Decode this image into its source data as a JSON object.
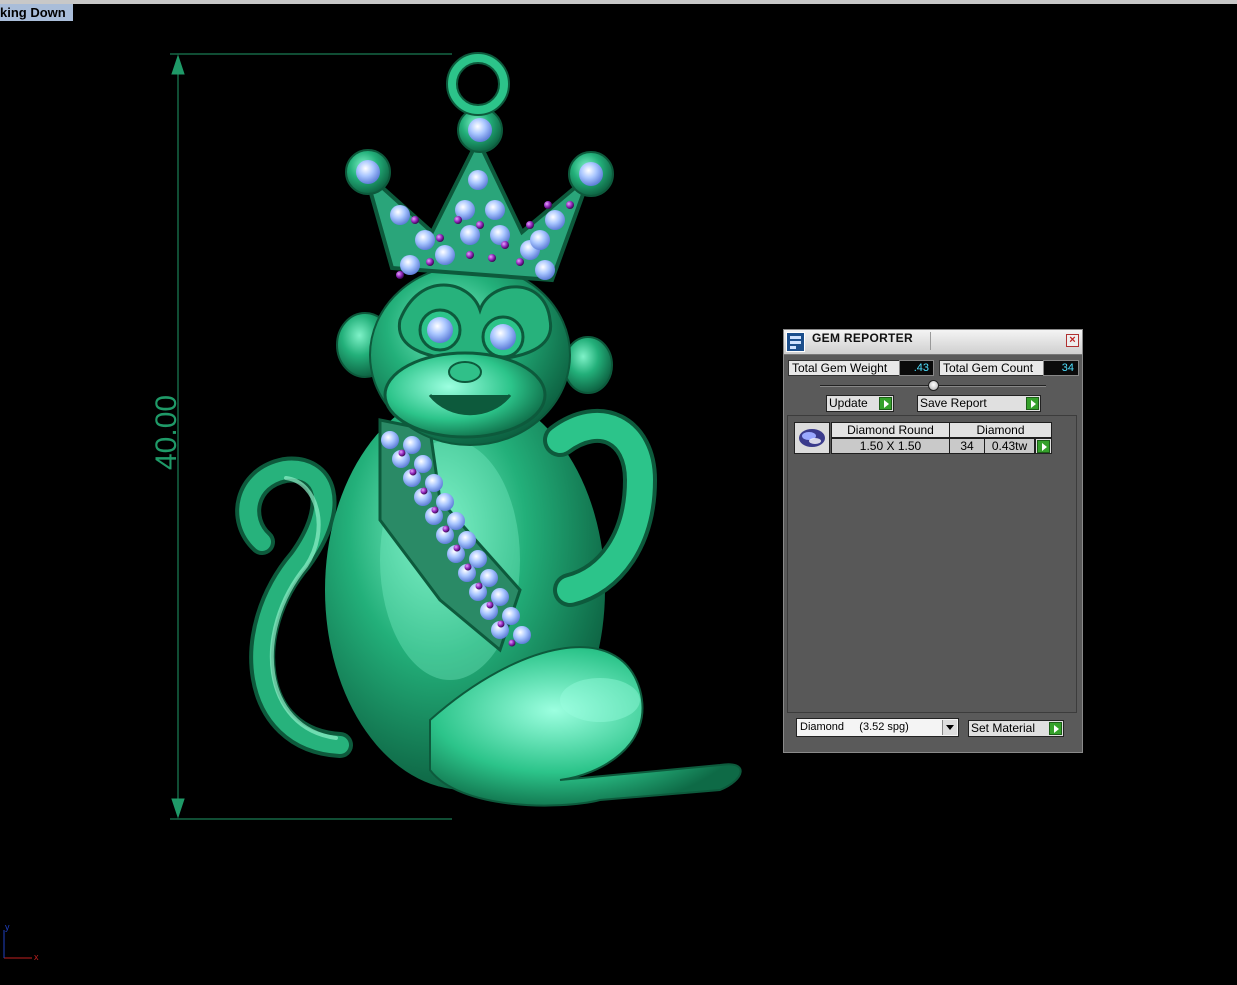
{
  "viewport": {
    "title": "king Down"
  },
  "dimension": {
    "value_label": "40.00"
  },
  "axes": {
    "x_label": "x",
    "y_label": "y"
  },
  "gem_reporter": {
    "title": "GEM REPORTER",
    "close_glyph": "×",
    "total_weight_label": "Total Gem Weight",
    "total_weight_value": ".43",
    "total_count_label": "Total Gem Count",
    "total_count_value": "34",
    "update_label": "Update",
    "save_report_label": "Save Report",
    "table": {
      "headers": [
        "Diamond Round",
        "Diamond"
      ],
      "rows": [
        {
          "size": "1.50 X 1.50",
          "count": "34",
          "weight": "0.43tw"
        }
      ]
    },
    "material_select": "Diamond     (3.52 spg)",
    "set_material_label": "Set Material"
  },
  "colors": {
    "metal_green": "#23b07a",
    "gem_blue": "#8fb4ff",
    "accent_purple": "#9a2cc6",
    "dimension_green": "#1f9a68",
    "button_green": "#35a12b"
  }
}
